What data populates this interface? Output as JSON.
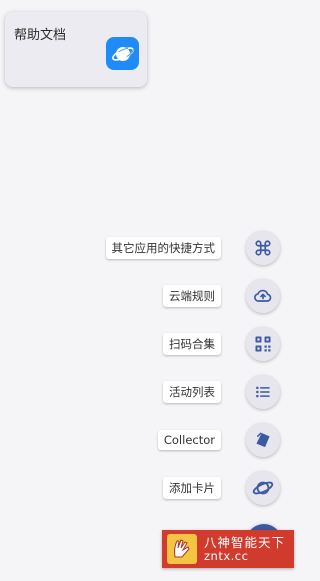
{
  "card": {
    "title": "帮助文档",
    "icon": "planet-icon"
  },
  "menu": [
    {
      "label": "其它应用的快捷方式",
      "icon": "command-icon"
    },
    {
      "label": "云端规则",
      "icon": "cloud-upload-icon"
    },
    {
      "label": "扫码合集",
      "icon": "qr-code-icon"
    },
    {
      "label": "活动列表",
      "icon": "list-icon"
    },
    {
      "label": "Collector",
      "icon": "tag-icon"
    },
    {
      "label": "添加卡片",
      "icon": "planet-icon"
    }
  ],
  "watermark": {
    "line1": "八神智能天下",
    "line2": "zntx.cc"
  },
  "colors": {
    "accent": "#3c5aa0",
    "card_icon": "#1f8bf6",
    "watermark_bg": "#d13b2e"
  }
}
